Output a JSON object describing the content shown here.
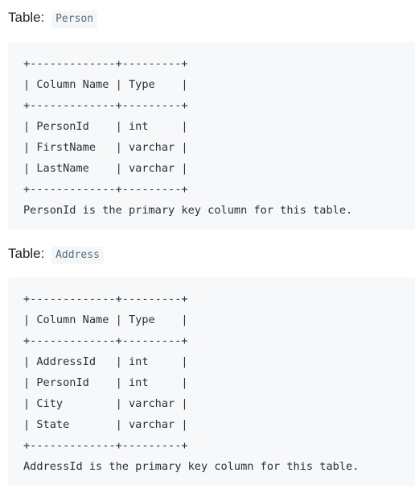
{
  "tables": [
    {
      "label": "Table:",
      "name": "Person",
      "lines": [
        "+-------------+---------+",
        "| Column Name | Type    |",
        "+-------------+---------+",
        "| PersonId    | int     |",
        "| FirstName   | varchar |",
        "| LastName    | varchar |",
        "+-------------+---------+",
        "PersonId is the primary key column for this table."
      ]
    },
    {
      "label": "Table:",
      "name": "Address",
      "lines": [
        "+-------------+---------+",
        "| Column Name | Type    |",
        "+-------------+---------+",
        "| AddressId   | int     |",
        "| PersonId    | int     |",
        "| City        | varchar |",
        "| State       | varchar |",
        "+-------------+---------+",
        "AddressId is the primary key column for this table."
      ]
    }
  ]
}
